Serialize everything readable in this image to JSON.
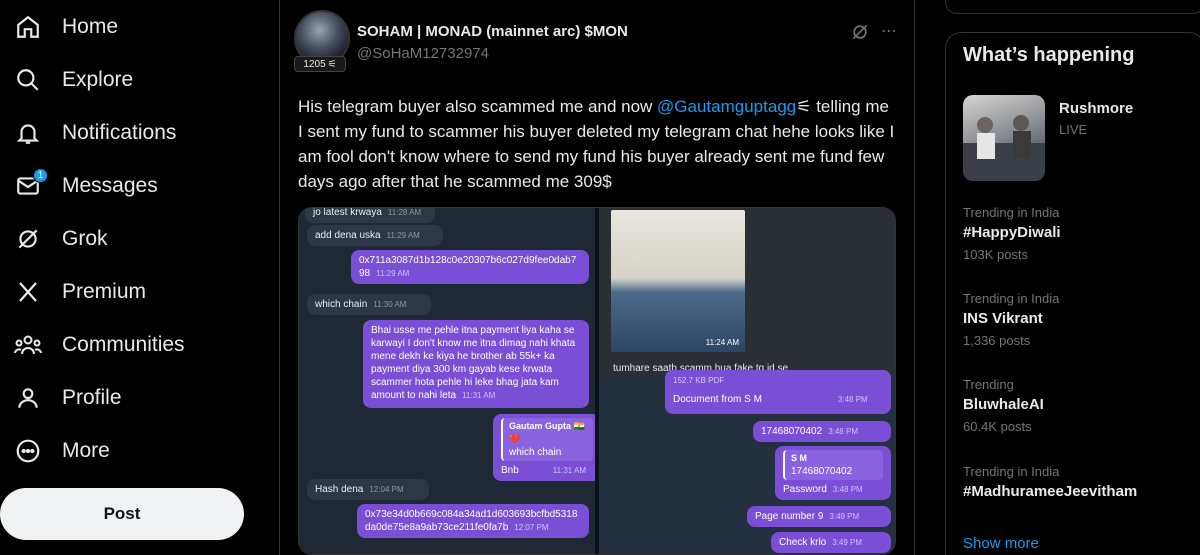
{
  "nav": {
    "items": [
      {
        "label": "Home",
        "icon": "home-icon"
      },
      {
        "label": "Explore",
        "icon": "search-icon"
      },
      {
        "label": "Notifications",
        "icon": "bell-icon"
      },
      {
        "label": "Messages",
        "icon": "mail-icon",
        "badge": "1"
      },
      {
        "label": "Grok",
        "icon": "grok-icon"
      },
      {
        "label": "Premium",
        "icon": "x-logo-icon"
      },
      {
        "label": "Communities",
        "icon": "communities-icon"
      },
      {
        "label": "Profile",
        "icon": "person-icon"
      },
      {
        "label": "More",
        "icon": "more-circle-icon"
      }
    ],
    "post_label": "Post"
  },
  "tweet": {
    "author_name": "SOHAM | MONAD (mainnet arc) $MON",
    "author_handle": "@SoHaM12732974",
    "score": "1205",
    "text_before": "His telegram buyer also scammed me and now ",
    "mention": "@Gautamguptagg",
    "text_after": " telling me I sent my fund to scammer his buyer deleted my telegram chat hehe looks like I am fool don't know where to send my fund his buyer already sent me fund few days ago after that he scammed me 309$"
  },
  "media": {
    "left_chat": {
      "top_fragment": "jo latest krwaya",
      "top_time": "11:28 AM",
      "msg1": {
        "text": "add dena uska",
        "time": "11:29 AM"
      },
      "msg2": {
        "text": "0x711a3087d1b128c0e20307b6c027d9fee0dab798",
        "time": "11:29 AM"
      },
      "msg3": {
        "text": "which chain",
        "time": "11:30 AM"
      },
      "msg4": {
        "text": "Bhai usse me pehle itna payment liya kaha se karwayi I don't know me itna dimag nahi khata mene dekh ke kiya he brother ab 55k+ ka payment diya 300 km gayab kese krwata scammer hota pehle hi leke bhag jata kam amount to nahi leta",
        "time": "11:31 AM"
      },
      "msg5": {
        "quote_name": "Gautam Gupta 🇮🇳❤️",
        "quote_text": "which chain",
        "text": "Bnb",
        "time": "11:31 AM"
      },
      "msg6": {
        "text": "Hash dena",
        "time": "12:04 PM"
      },
      "msg7": {
        "text": "0x73e34d0b669c084a34ad1d603693bcfbd5318da0de75e8a9ab73ce211fe0fa7b",
        "time": "12:07 PM"
      }
    },
    "right_top": {
      "photo_time": "11:24 AM",
      "caption": "tumhare saath scamm hua fake tg id se"
    },
    "right_bottom": {
      "pdf_size": "152.7 KB PDF",
      "doc": {
        "text": "Document from S M",
        "time": "3:48 PM"
      },
      "num": {
        "text": "17468070402",
        "time": "3:48 PM"
      },
      "pw": {
        "quote_name": "S M",
        "quote_text": "17468070402",
        "text": "Password",
        "time": "3:48 PM"
      },
      "page": {
        "text": "Page number 9",
        "time": "3:49 PM"
      },
      "check": {
        "text": "Check krlo",
        "time": "3:49 PM"
      }
    }
  },
  "sidebar": {
    "title": "What’s happening",
    "live": {
      "name": "Rushmore",
      "status": "LIVE"
    },
    "trends": [
      {
        "context": "Trending in India",
        "name": "#HappyDiwali",
        "posts": "103K posts"
      },
      {
        "context": "Trending in India",
        "name": "INS Vikrant",
        "posts": "1,336 posts"
      },
      {
        "context": "Trending",
        "name": "BluwhaleAI",
        "posts": "60.4K posts"
      },
      {
        "context": "Trending in India",
        "name": "#MadhurameeJeevitham",
        "posts": ""
      }
    ],
    "show_more": "Show more"
  },
  "colors": {
    "accent": "#1d9bf0",
    "background": "#000000",
    "border": "#2f3336",
    "muted": "#71767b",
    "telegram_out": "#7a4fd6"
  }
}
